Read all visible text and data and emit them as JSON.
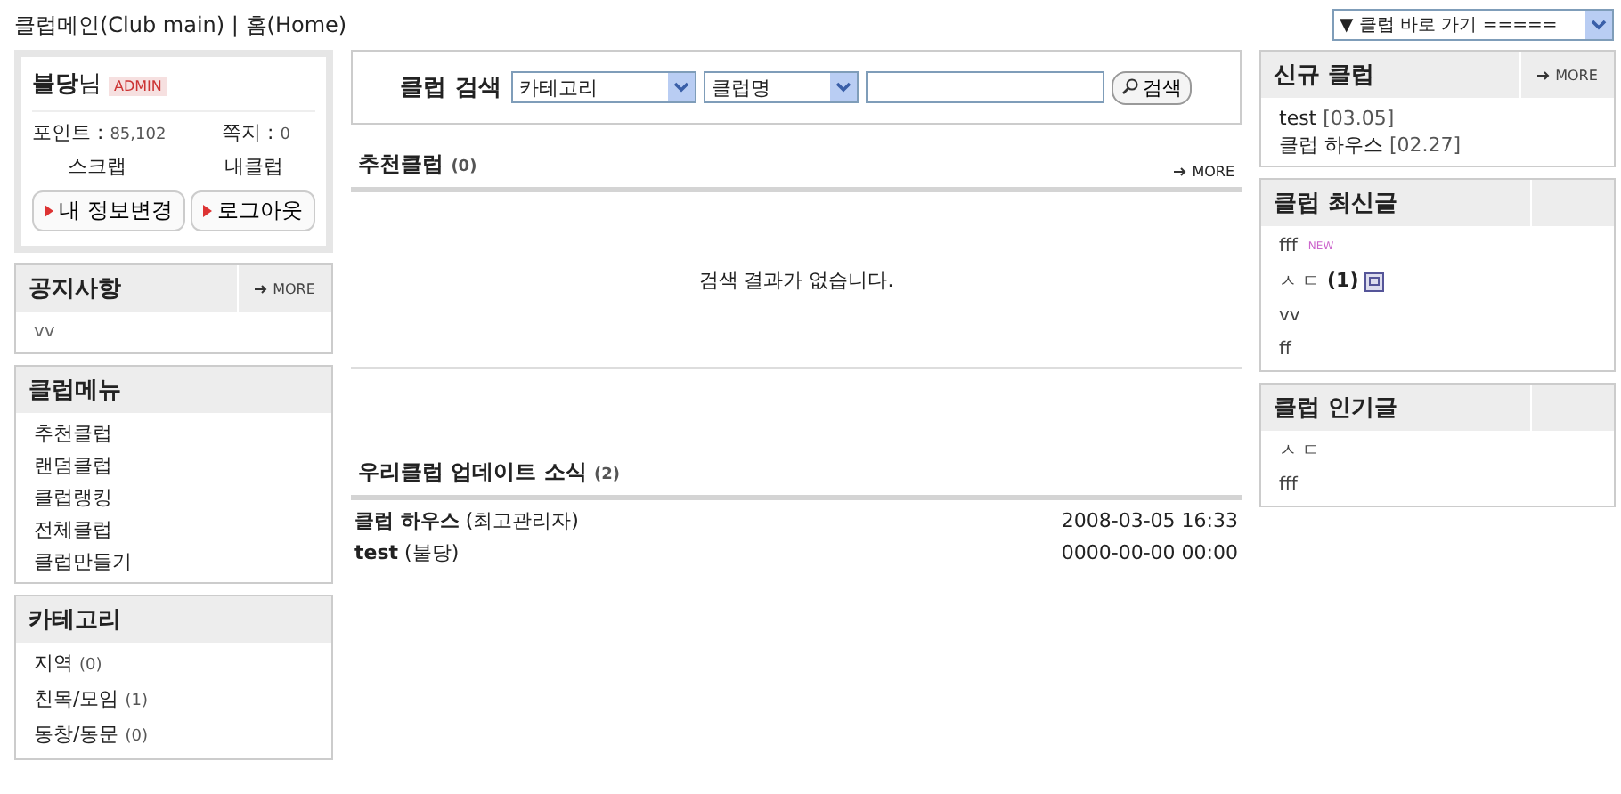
{
  "breadcrumb": "클럽메인(Club main) | 홈(Home)",
  "quick_nav": {
    "label": "▼ 클럽 바로 가기 ====="
  },
  "profile": {
    "name": "불당",
    "suffix": "님",
    "badge": "ADMIN",
    "points_label": "포인트 :",
    "points": "85,102",
    "notes_label": "쪽지 :",
    "notes": "0",
    "links": [
      "스크랩",
      "내클럽"
    ],
    "buttons": [
      "내 정보변경",
      "로그아웃"
    ]
  },
  "notice": {
    "title": "공지사항",
    "more": "MORE",
    "items": [
      "vv"
    ]
  },
  "club_menu": {
    "title": "클럽메뉴",
    "items": [
      "추천클럽",
      "랜덤클럽",
      "클럽랭킹",
      "전체클럽",
      "클럽만들기"
    ]
  },
  "category": {
    "title": "카테고리",
    "items": [
      {
        "label": "지역",
        "count": "(0)"
      },
      {
        "label": "친목/모임",
        "count": "(1)"
      },
      {
        "label": "동창/동문",
        "count": "(0)"
      }
    ]
  },
  "search": {
    "label": "클럽 검색",
    "selects": [
      "카테고리",
      "클럽명"
    ],
    "button": "검색"
  },
  "recommended": {
    "title": "추천클럽",
    "count": "(0)",
    "more": "MORE",
    "empty": "검색 결과가 없습니다."
  },
  "updates": {
    "title": "우리클럽 업데이트 소식",
    "count": "(2)",
    "rows": [
      {
        "club": "클럽 하우스",
        "who": "(최고관리자)",
        "date": "2008-03-05 16:33"
      },
      {
        "club": "test",
        "who": "(불당)",
        "date": "0000-00-00 00:00"
      }
    ]
  },
  "new_clubs": {
    "title": "신규 클럽",
    "more": "MORE",
    "items": [
      {
        "name": "test",
        "date": "[03.05]"
      },
      {
        "name": "클럽 하우스",
        "date": "[02.27]"
      }
    ]
  },
  "latest_posts": {
    "title": "클럽 최신글",
    "items": [
      {
        "text": "fff",
        "badge": "NEW",
        "attachment": false
      },
      {
        "text": "ㅅ ㄷ",
        "comments": "(1)",
        "attachment": true
      },
      {
        "text": "vv",
        "attachment": false
      },
      {
        "text": "ff",
        "attachment": false
      }
    ]
  },
  "popular_posts": {
    "title": "클럽 인기글",
    "items": [
      "ㅅ ㄷ",
      "fff"
    ]
  }
}
